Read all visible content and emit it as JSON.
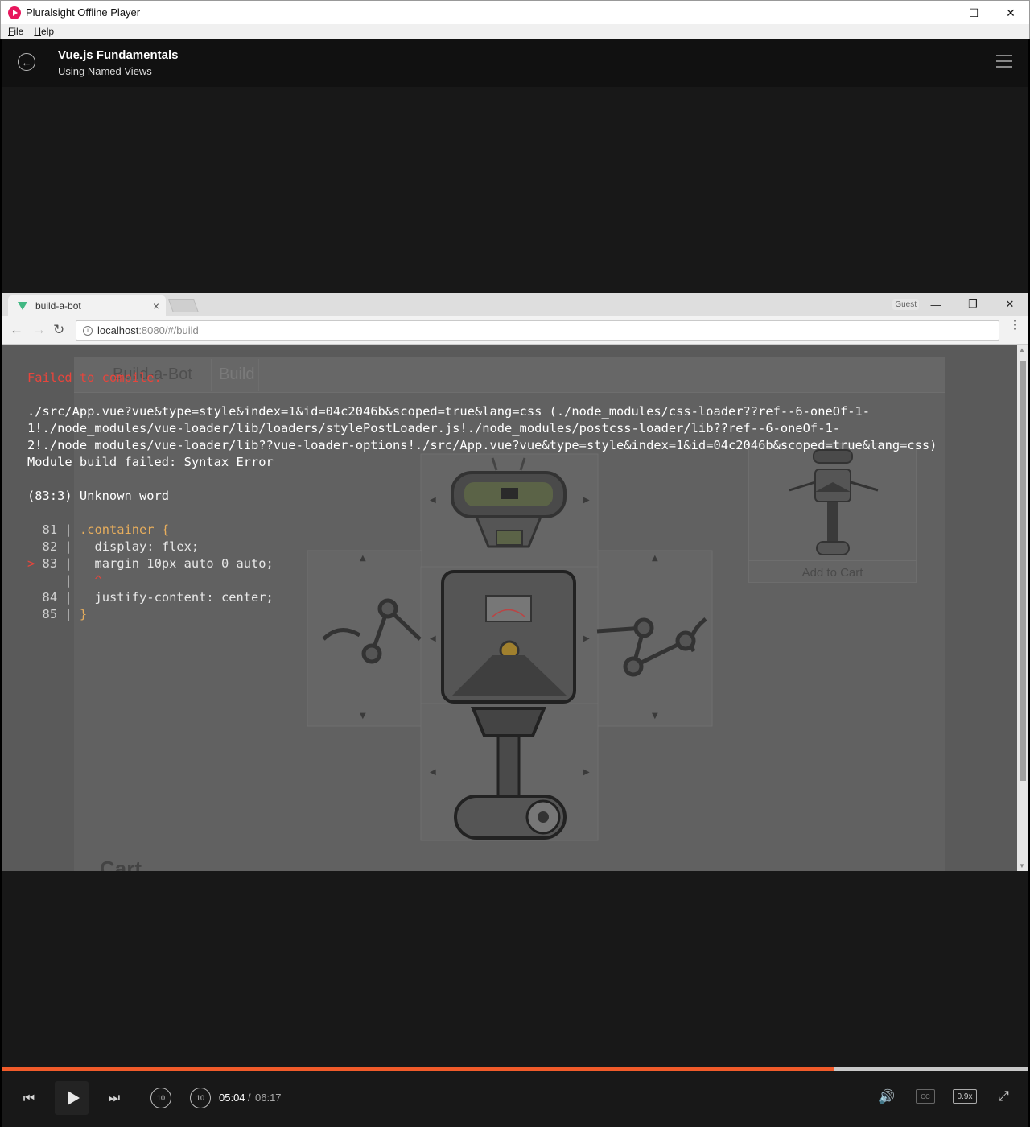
{
  "window": {
    "title": "Pluralsight Offline Player",
    "minimize": "—",
    "maximize": "☐",
    "close": "✕"
  },
  "menu": {
    "file": "File",
    "help": "Help"
  },
  "header": {
    "back_icon": "←",
    "course": "Vue.js Fundamentals",
    "module": "Using Named Views"
  },
  "browser": {
    "tab_title": "build-a-bot",
    "tab_close": "×",
    "guest": "Guest",
    "min": "—",
    "restore": "❐",
    "close": "✕",
    "back": "←",
    "forward": "→",
    "reload": "↻",
    "info_icon": "i",
    "url_host": "localhost",
    "url_rest": ":8080/#/build",
    "kebab": "⋮"
  },
  "site": {
    "nav_title": "Build-a-Bot",
    "nav_build": "Build",
    "add_to_cart": "Add to Cart",
    "cart_heading": "Cart",
    "arrow_up": "▲",
    "arrow_down": "▼",
    "arrow_left": "◀",
    "arrow_right": "▶"
  },
  "error": {
    "title": "Failed to compile.",
    "path_line_1": "./src/App.vue?vue&type=style&index=1&id=04c2046b&scoped=true&lang=css (./node_modules/css-loader??ref--6-oneOf-1-",
    "path_line_2": "1!./node_modules/vue-loader/lib/loaders/stylePostLoader.js!./node_modules/postcss-loader/lib??ref--6-oneOf-1-",
    "path_line_3": "2!./node_modules/vue-loader/lib??vue-loader-options!./src/App.vue?vue&type=style&index=1&id=04c2046b&scoped=true&lang=css)",
    "module_failed": "Module build failed: Syntax Error",
    "unknown_word": "(83:3) Unknown word",
    "code": [
      {
        "marker": "  ",
        "num": "81",
        "bar": " | ",
        "text": ".container {",
        "kind": "kw"
      },
      {
        "marker": "  ",
        "num": "82",
        "bar": " | ",
        "text": "  display: flex;",
        "kind": "prop"
      },
      {
        "marker": "> ",
        "num": "83",
        "bar": " | ",
        "text": "  margin 10px auto 0 auto;",
        "kind": "prop"
      },
      {
        "marker": "  ",
        "num": "  ",
        "bar": " | ",
        "text": "  ^",
        "kind": "caret"
      },
      {
        "marker": "  ",
        "num": "84",
        "bar": " | ",
        "text": "  justify-content: center;",
        "kind": "prop"
      },
      {
        "marker": "  ",
        "num": "85",
        "bar": " | ",
        "text": "}",
        "kind": "kw"
      }
    ]
  },
  "controls": {
    "prev": "⏮",
    "next": "⏭",
    "rewind": "10",
    "forward": "10",
    "time_current": "05:04",
    "time_sep": "/",
    "time_total": "06:17",
    "volume": "🔊",
    "cc": "CC",
    "speed": "0.9x",
    "fullscreen": "⤢",
    "progress": 0.81
  },
  "colors": {
    "accent": "#f15b2a",
    "brand": "#e8175d",
    "error": "#e8453c"
  }
}
